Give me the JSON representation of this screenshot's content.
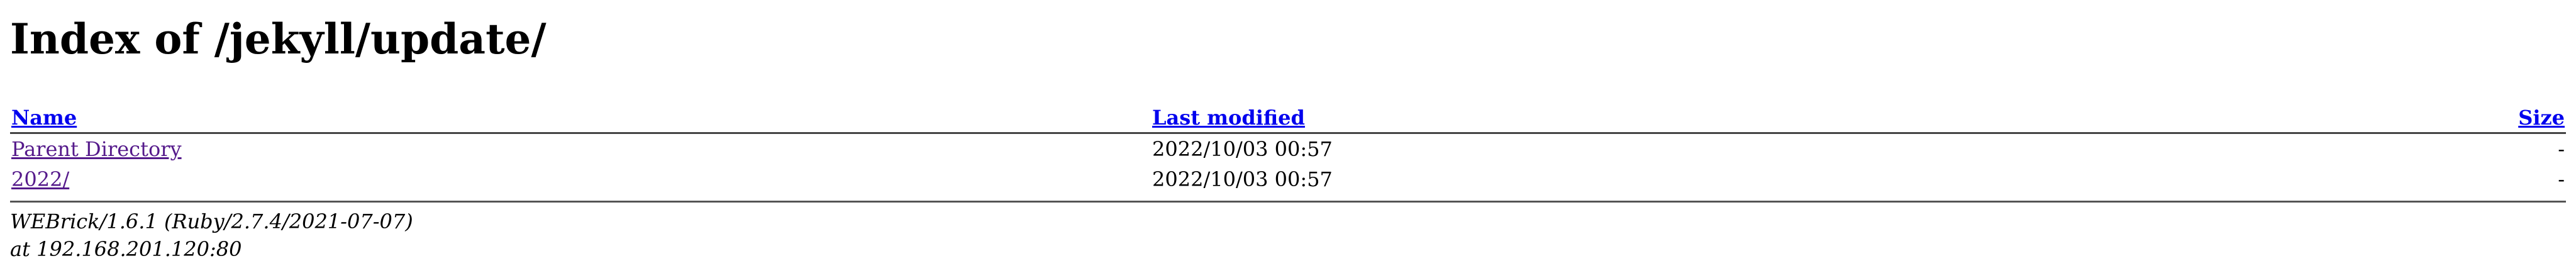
{
  "page": {
    "title": "Index of /jekyll/update/"
  },
  "table": {
    "headers": {
      "name": "Name",
      "modified": "Last modified",
      "size": "Size"
    },
    "rows": [
      {
        "name": "Parent Directory",
        "modified": "2022/10/03 00:57",
        "size": "-"
      },
      {
        "name": "2022/",
        "modified": "2022/10/03 00:57",
        "size": "-"
      }
    ]
  },
  "footer": {
    "server": "WEBrick/1.6.1 (Ruby/2.7.4/2021-07-07)",
    "address": "at 192.168.201.120:80"
  }
}
